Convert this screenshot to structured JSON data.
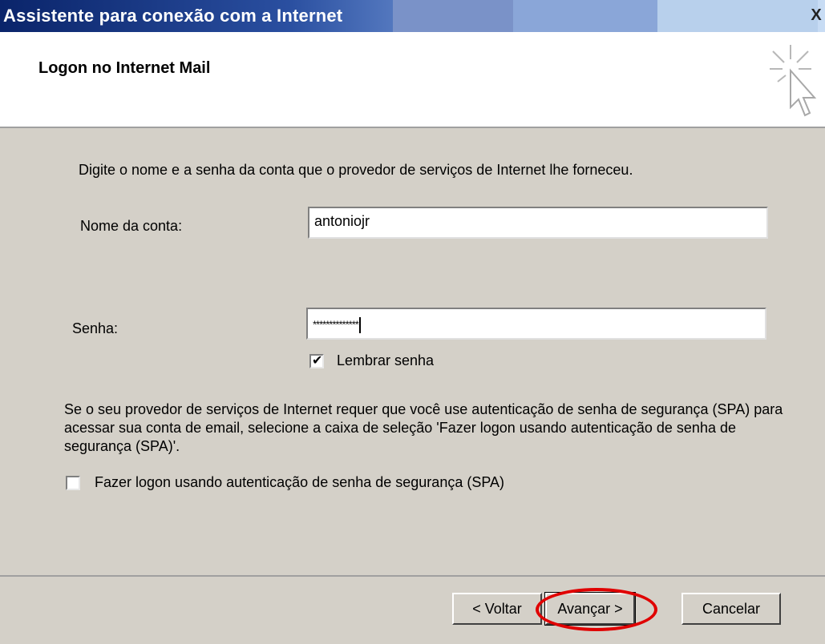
{
  "window": {
    "title": "Assistente para conexão com a Internet",
    "close_symbol": "X"
  },
  "header": {
    "heading": "Logon no Internet Mail",
    "icon": "wizard-cursor-icon"
  },
  "form": {
    "instruction": "Digite o nome e a senha da conta que o provedor de serviços de Internet lhe forneceu.",
    "account_label": "Nome da conta:",
    "account_value": "antoniojr",
    "password_label": "Senha:",
    "password_value": "**************",
    "remember_label": "Lembrar senha",
    "remember_checked": true,
    "spa_text": "Se o seu provedor de serviços de Internet requer que você use autenticação de senha de segurança (SPA) para acessar sua conta de email, selecione a caixa de seleção 'Fazer logon usando autenticação de senha de segurança (SPA)'.",
    "spa_label": "Fazer logon usando autenticação de senha de segurança (SPA)",
    "spa_checked": false
  },
  "buttons": {
    "back": "< Voltar",
    "next": "Avançar >",
    "cancel": "Cancelar"
  },
  "colors": {
    "titlebar_start": "#0a246a",
    "panel": "#d4d0c8",
    "highlight": "#e00000"
  }
}
